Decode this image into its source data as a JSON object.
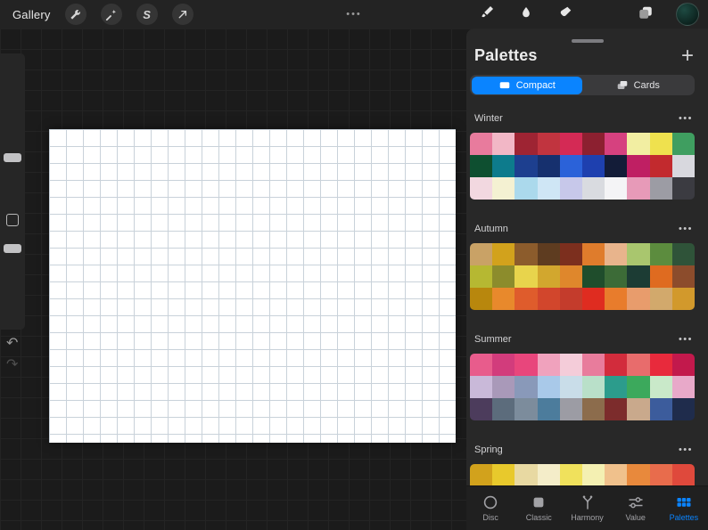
{
  "topbar": {
    "gallery_label": "Gallery",
    "menu_dots": "•••",
    "selection_glyph": "S",
    "color_swatch": "#153f38"
  },
  "palettes_panel": {
    "title": "Palettes",
    "add_label": "+",
    "section_menu": "•••",
    "accent_color": "#0a84ff",
    "view_tabs": [
      {
        "label": "Compact",
        "icon": "compact-icon",
        "selected": true
      },
      {
        "label": "Cards",
        "icon": "cards-icon",
        "selected": false
      }
    ],
    "sections": [
      {
        "name": "Winter",
        "rows": [
          [
            "#e87b9d",
            "#f2b7c6",
            "#9e2433",
            "#c1343f",
            "#d42a55",
            "#8c2030",
            "#d6417f",
            "#f2eea2",
            "#efe14e",
            "#3f9e60"
          ],
          [
            "#0e4f30",
            "#0d7b8c",
            "#1d3f8f",
            "#16306e",
            "#2b62d9",
            "#1e40af",
            "#131c38",
            "#bf1f63",
            "#c22a2e",
            "#d8d8de"
          ],
          [
            "#f2d8e0",
            "#f4f1d2",
            "#abd9ec",
            "#cfe6f5",
            "#c7c8ea",
            "#d9dbe0",
            "#f4f4f6",
            "#e79ab8",
            "#9c9ca4",
            "#3b3b41"
          ]
        ]
      },
      {
        "name": "Autumn",
        "rows": [
          [
            "#c9a266",
            "#d2a21c",
            "#8c5c2c",
            "#5e3c20",
            "#7c2f1e",
            "#df7c2c",
            "#e8b48c",
            "#a9c66e",
            "#5c8c3e",
            "#2f5339"
          ],
          [
            "#b6b832",
            "#8c8c2c",
            "#e8d44c",
            "#d2a72e",
            "#df872c",
            "#1f4d2c",
            "#3c6b37",
            "#1c3c34",
            "#df6b20",
            "#8c4c2c"
          ],
          [
            "#b8870d",
            "#e8892c",
            "#df5c2c",
            "#d2462c",
            "#c43c2c",
            "#df2c20",
            "#e87c2c",
            "#e89c6c",
            "#d2a96c",
            "#d2992c"
          ]
        ]
      },
      {
        "name": "Summer",
        "rows": [
          [
            "#e85c8c",
            "#d23c7c",
            "#e8467c",
            "#f0a2bd",
            "#f4ccd9",
            "#e87c9c",
            "#d22c3c",
            "#e86c6c",
            "#e82a3c",
            "#c2194c"
          ],
          [
            "#c9b9d9",
            "#a999b9",
            "#8999b9",
            "#a9c9e9",
            "#c9dde9",
            "#b9e0c9",
            "#2c9c8c",
            "#3ca95c",
            "#c9e9c9",
            "#e8a9c9"
          ],
          [
            "#4c3c5c",
            "#5c6c7c",
            "#7c8c9c",
            "#4c7c9c",
            "#9c9ca4",
            "#8c6c4c",
            "#7c2c2c",
            "#c9a98c",
            "#3c5c9c",
            "#1f2c4c"
          ]
        ]
      },
      {
        "name": "Spring",
        "rows": [
          [
            "#d2a21c",
            "#e8c92c",
            "#e8d9a2",
            "#f4edc9",
            "#f0e15c",
            "#f4f0b2",
            "#f0c18c",
            "#e8893c",
            "#e86c4c",
            "#df493c"
          ],
          [
            "#e8992c",
            "#d2892c",
            "#e8c93c",
            "#f0d94c",
            "#e8b92c",
            "#f0e98c",
            "#e8a95c",
            "#df7c3c",
            "#d25c3c",
            "#c2493c"
          ]
        ]
      }
    ]
  },
  "bottom_tabs": [
    {
      "label": "Disc",
      "icon": "disc-icon",
      "selected": false
    },
    {
      "label": "Classic",
      "icon": "classic-icon",
      "selected": false
    },
    {
      "label": "Harmony",
      "icon": "harmony-icon",
      "selected": false
    },
    {
      "label": "Value",
      "icon": "value-icon",
      "selected": false
    },
    {
      "label": "Palettes",
      "icon": "palettes-icon",
      "selected": true
    }
  ]
}
